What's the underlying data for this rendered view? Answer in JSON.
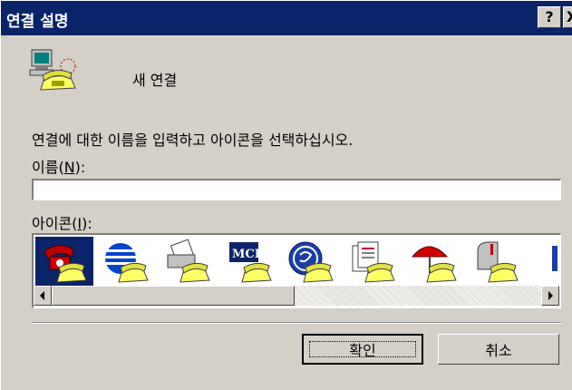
{
  "window": {
    "title": "연결 설명",
    "help_label": "?",
    "close_label": "X"
  },
  "header": {
    "connection_name": "새 연결",
    "icon": "phone-computer-icon"
  },
  "form": {
    "instruction": "연결에 대한 이름을 입력하고 아이콘을 선택하십시오.",
    "name_label_prefix": "이름(",
    "name_label_key": "N",
    "name_label_suffix": "):",
    "name_value": "",
    "icon_label_prefix": "아이콘(",
    "icon_label_key": "I",
    "icon_label_suffix": "):"
  },
  "icon_list": {
    "items": [
      {
        "icon": "red-phone-icon",
        "selected": true
      },
      {
        "icon": "globe-stripes-icon",
        "selected": false
      },
      {
        "icon": "fax-phone-icon",
        "selected": false
      },
      {
        "icon": "mci-logo-icon",
        "selected": false,
        "text": "MCI"
      },
      {
        "icon": "ge-logo-icon",
        "selected": false
      },
      {
        "icon": "documents-phone-icon",
        "selected": false
      },
      {
        "icon": "umbrella-phone-icon",
        "selected": false
      },
      {
        "icon": "mailbox-phone-icon",
        "selected": false
      },
      {
        "icon": "partial-icon",
        "selected": false
      }
    ]
  },
  "buttons": {
    "ok_label": "확인",
    "cancel_label": "취소"
  },
  "colors": {
    "titlebar": "#0a246a",
    "dialog_bg": "#d4d0c8",
    "selection": "#0a246a"
  }
}
